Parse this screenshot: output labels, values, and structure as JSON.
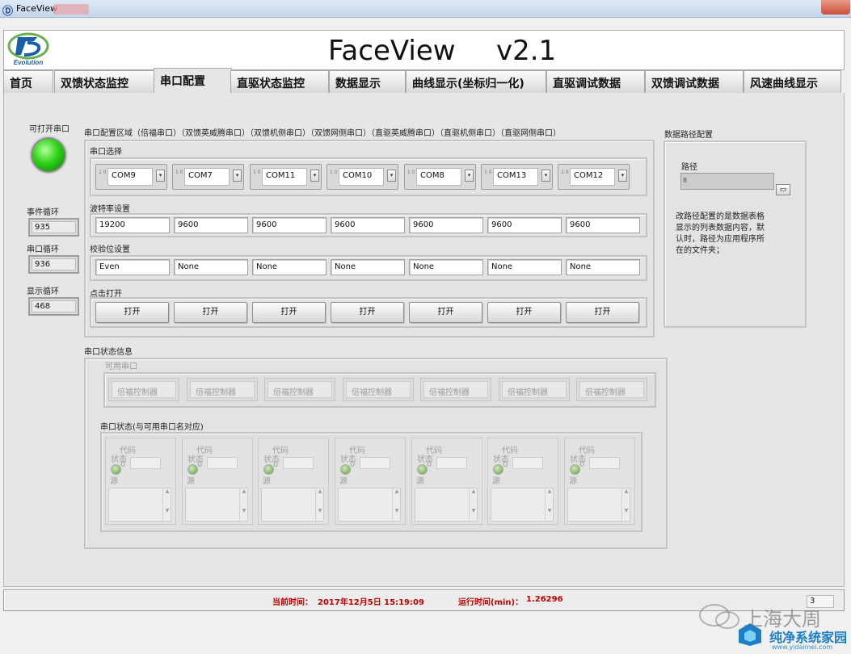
{
  "window": {
    "title": "FaceView",
    "title_redacted_tail": ""
  },
  "header": {
    "logo_text": "Evolution",
    "logo_letter": "D",
    "app_name": "FaceView",
    "version": "v2.1"
  },
  "tabs": [
    {
      "label": "首页",
      "active": false
    },
    {
      "label": "双馈状态监控",
      "active": false
    },
    {
      "label": "串口配置",
      "active": true
    },
    {
      "label": "直驱状态监控",
      "active": false
    },
    {
      "label": "数据显示",
      "active": false
    },
    {
      "label": "曲线显示(坐标归一化)",
      "active": false
    },
    {
      "label": "直驱调试数据",
      "active": false
    },
    {
      "label": "双馈调试数据",
      "active": false
    },
    {
      "label": "风速曲线显示",
      "active": false
    }
  ],
  "left": {
    "open_port_label": "可打开串口",
    "event_loop_label": "事件循环",
    "event_loop_value": "935",
    "serial_loop_label": "串口循环",
    "serial_loop_value": "936",
    "display_loop_label": "显示循环",
    "display_loop_value": "468"
  },
  "config": {
    "area_title": "串口配置区域（倍福串口）（双馈英威腾串口）（双馈机侧串口）（双馈网侧串口）（直驱英威腾串口）（直驱机侧串口）（直驱网侧串口）",
    "port_select_label": "串口选择",
    "index_glyph": "1 0",
    "ports": [
      "COM9",
      "COM7",
      "COM11",
      "COM10",
      "COM8",
      "COM13",
      "COM12"
    ],
    "baud_label": "波特率设置",
    "bauds": [
      "19200",
      "9600",
      "9600",
      "9600",
      "9600",
      "9600",
      "9600"
    ],
    "parity_label": "校验位设置",
    "parities": [
      "Even",
      "None",
      "None",
      "None",
      "None",
      "None",
      "None"
    ],
    "open_label": "点击打开",
    "open_buttons": [
      "打开",
      "打开",
      "打开",
      "打开",
      "打开",
      "打开",
      "打开"
    ]
  },
  "status": {
    "title": "串口状态信息",
    "available_label": "可用串口",
    "available": [
      "倍福控制器",
      "倍福控制器",
      "倍福控制器",
      "倍福控制器",
      "倍福控制器",
      "倍福控制器",
      "倍福控制器"
    ],
    "state_label": "串口状态(与可用串口名对应)",
    "code_label": "代码",
    "state_word": "状态",
    "code_value": "0",
    "source_label": "源",
    "count": 7
  },
  "path": {
    "title": "数据路径配置",
    "label": "路径",
    "prefix_glyph": "8",
    "description": "改路径配置的是数据表格显示的列表数据内容，默认时，路径为应用程序所在的文件夹；"
  },
  "statusbar": {
    "current_time_label": "当前时间：",
    "current_time_value": "2017年12月5日   15:19:09",
    "run_time_label": "运行时间(min)：",
    "run_time_value": "1.26296",
    "page": "3"
  },
  "watermark": {
    "account": "上海大周",
    "site_name": "纯净系统家园",
    "site_url": "www.yidaimei.com"
  },
  "colors": {
    "led_on": "#2fd21a",
    "status_red": "#c00000",
    "wm_blue": "#1c7fc4"
  }
}
